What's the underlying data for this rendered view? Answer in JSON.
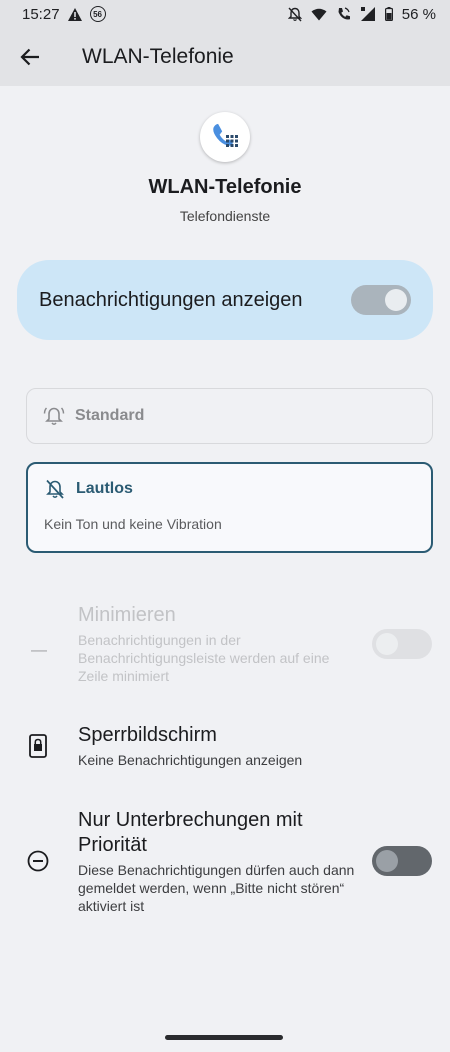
{
  "status_bar": {
    "time": "15:27",
    "badge_number": "56",
    "battery": "56 %",
    "icons": [
      "warning-icon",
      "bell-off-icon",
      "wifi-icon",
      "wifi-calling-icon",
      "signal-icon",
      "battery-icon"
    ]
  },
  "app_bar": {
    "title": "WLAN-Telefonie",
    "back_icon": "arrow-left-icon"
  },
  "app_header": {
    "name": "WLAN-Telefonie",
    "subtitle": "Telefondienste",
    "icon": "phone-dialpad-icon",
    "icon_color": "#4a8fe0"
  },
  "notifications": {
    "label": "Benachrichtigungen anzeigen",
    "enabled": true
  },
  "options": {
    "standard": {
      "label": "Standard",
      "icon": "bell-ring-icon"
    },
    "lautlos": {
      "label": "Lautlos",
      "desc": "Kein Ton und keine Vibration",
      "icon": "bell-off-icon",
      "selected": true
    }
  },
  "settings": {
    "minimize": {
      "title": "Minimieren",
      "subtitle": "Benachrichtigungen in der Benachrichtigungsleiste werden auf eine Zeile minimiert",
      "enabled": false,
      "disabled": true
    },
    "lockscreen": {
      "title": "Sperrbildschirm",
      "subtitle": "Keine Benachrichtigungen anzeigen",
      "icon": "lock-screen-phone-icon"
    },
    "priority": {
      "title": "Nur Unterbrechungen mit Priorität",
      "subtitle": "Diese Benachrichtigungen dürfen auch dann gemeldet werden, wenn „Bitte nicht stören“ aktiviert ist",
      "enabled": false,
      "icon": "do-not-disturb-icon"
    }
  },
  "colors": {
    "accent": "#2b5b73",
    "highlight_card": "#cde6f7",
    "background": "#f0f1f4"
  }
}
